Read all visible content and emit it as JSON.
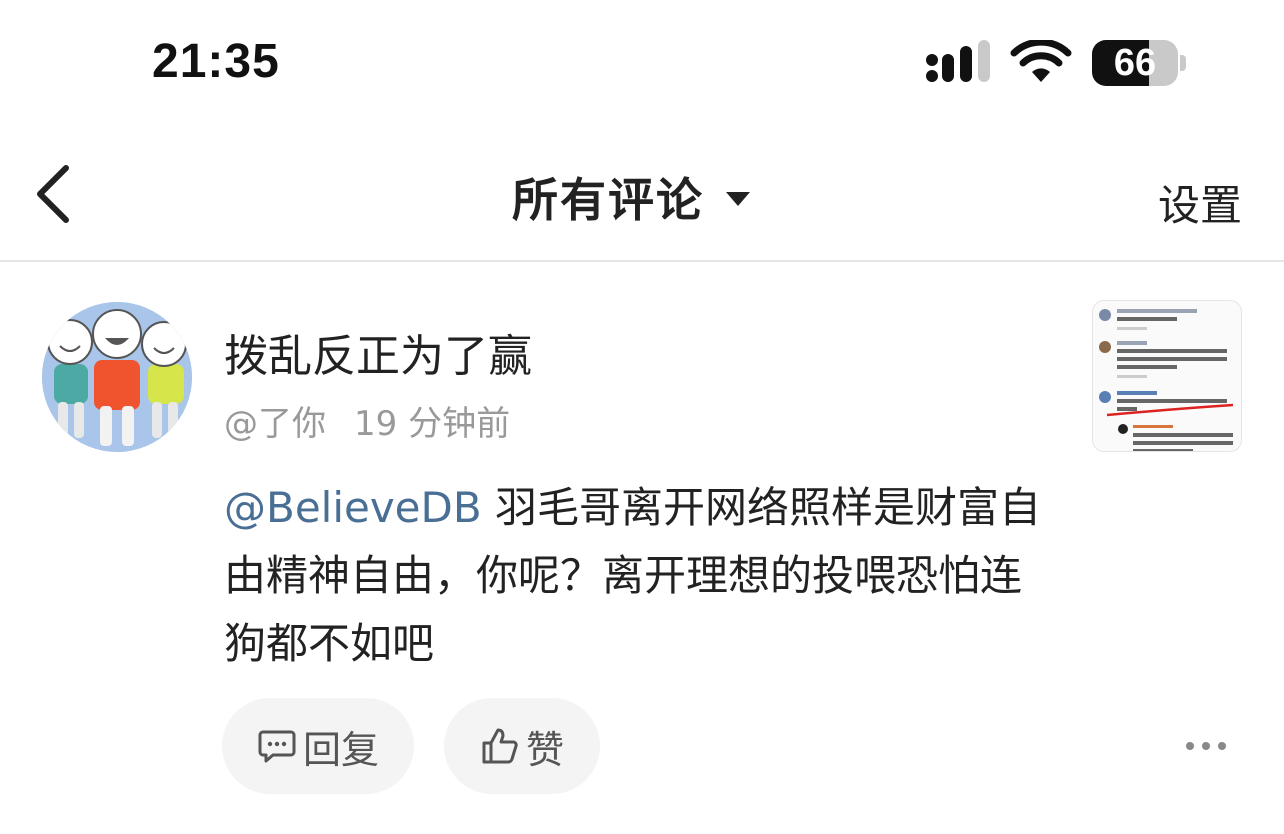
{
  "status_bar": {
    "time": "21:35",
    "battery_percent": "66",
    "battery_level": 0.66,
    "icons": [
      "cellular-signal-icon",
      "wifi-icon",
      "battery-icon"
    ]
  },
  "nav": {
    "back_icon": "chevron-left-icon",
    "title": "所有评论",
    "title_icon": "caret-down-icon",
    "settings_label": "设置"
  },
  "comment": {
    "avatar_icon": "cartoon-friends-avatar",
    "username": "拨乱反正为了赢",
    "reply_to": "@了你",
    "time_ago": "19 分钟前",
    "mention": "@BelieveDB",
    "text": " 羽毛哥离开网络照样是财富自由精神自由，你呢？离开理想的投喂恐怕连狗都不如吧",
    "thumbnail_icon": "comment-screenshot-thumbnail",
    "actions": {
      "reply_label": "回复",
      "reply_icon": "comment-bubble-icon",
      "like_label": "赞",
      "like_icon": "thumbs-up-icon",
      "more_icon": "more-dots-icon"
    }
  },
  "colors": {
    "mention": "#4a6f95",
    "meta_text": "#999999",
    "pill_bg": "#f4f4f4"
  }
}
